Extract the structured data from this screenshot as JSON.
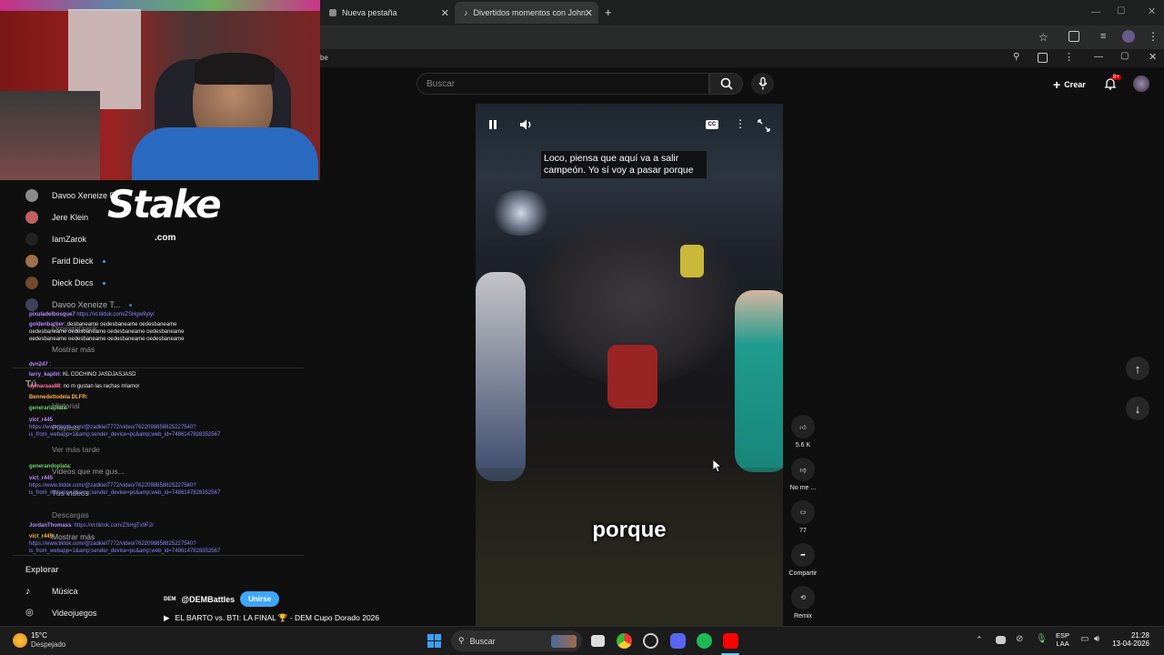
{
  "browser": {
    "tabs": [
      {
        "label": "Nueva pestaña"
      },
      {
        "label": "Divertidos momentos con John"
      }
    ],
    "new_tab": "+",
    "yt_strip_fragment": "be"
  },
  "youtube": {
    "search_placeholder": "Buscar",
    "create_label": "Crear",
    "notifications_badge": "9+"
  },
  "video": {
    "subtitle_top": "Loco, piensa que aquí va a salir campeón. Yo sí voy a pasar porque",
    "caption_big": "porque",
    "cc_label": "CC",
    "actions": {
      "likes": "5.6 K",
      "dislike_label": "No me ...",
      "comments": "77",
      "share_label": "Compartir",
      "remix_label": "Remix"
    }
  },
  "overlay": {
    "stake_logo": "Stake",
    "stake_domain": ".com"
  },
  "sidebar": {
    "subscriptions": [
      {
        "name": "Davoo Xeneize P...",
        "color": "#8a8a8a",
        "dot": false
      },
      {
        "name": "Jere Klein",
        "color": "#c06060",
        "dot": false
      },
      {
        "name": "IamZarok",
        "color": "#222222",
        "dot": false
      },
      {
        "name": "Farid Dieck",
        "color": "#a0704a",
        "dot": true
      },
      {
        "name": "Dieck Docs",
        "color": "#704a2a",
        "dot": true
      },
      {
        "name": "Davoo Xeneize T...",
        "color": "#555577",
        "dot": true
      }
    ],
    "overlapped_items": [
      "Drossrotzank",
      "Mostrar más",
      "Tú",
      "Historial",
      "Playlists",
      "Ver más tarde",
      "Videos que me gus...",
      "Tus videos",
      "Descargas",
      "Mostrar más"
    ],
    "explore_title": "Explorar",
    "explore_items": [
      {
        "label": "Música"
      },
      {
        "label": "Videojuegos"
      }
    ]
  },
  "chat": [
    {
      "user": "pixuladelbosque7",
      "text": "https://vt.tiktok.com/ZSHgw9yty/"
    },
    {
      "user": "goldenbarber",
      "text": ": desbaneame oedesbaneame oedesbaneame oedesbaneame oedesbaneame oedesbaneame oedesbaneame oedesbaneame oedesbaneame oedesbaneame oedesbaneame"
    },
    {
      "user": "dvn247",
      "text": ":"
    },
    {
      "user": "larry_kaplin",
      "text": ": KL COCHINO JASDJASJASD"
    },
    {
      "user": "aymaraaa88",
      "text": ": no m gustan las rachas mlamor"
    },
    {
      "user": "Bennedettodela DLFR",
      "text": ":"
    },
    {
      "user": "generarlaplata",
      "text": ":"
    },
    {
      "user": "vict_r445",
      "text": "https://www.tiktok.com/@zadkiel7772/video/7622098658825227540?is_from_webapp=1&amp;sender_device=pc&amp;web_id=7486147828352567"
    },
    {
      "user": "generandoplata",
      "text": ":"
    },
    {
      "user": "vict_r445",
      "text": "https://www.tiktok.com/@zadkiel7772/video/7622098658825227540?is_from_webapp=1&amp;sender_device=pc&amp;web_id=7486147828352567"
    },
    {
      "user": "JordanThomass",
      "text": ": https://vt.tiktok.com/ZSHgTx9F2/"
    },
    {
      "user": "vict_r445",
      "text": "https://www.tiktok.com/@zadkiel7772/video/7622098658825227540?is_from_webapp=1&amp;sender_device=pc&amp;web_id=7486147828352567"
    }
  ],
  "channel": {
    "handle": "@DEMBattles",
    "join_label": "Unirse",
    "logo": "DEM",
    "video_title": "EL BARTO vs. BTI: LA FINAL 🏆 - DEM Cupo Dorado 2026"
  },
  "taskbar": {
    "weather_temp": "15°C",
    "weather_desc": "Despejado",
    "search_label": "Buscar",
    "lang_top": "ESP",
    "lang_bottom": "LAA",
    "time": "21:28",
    "date": "13-04-2026"
  }
}
